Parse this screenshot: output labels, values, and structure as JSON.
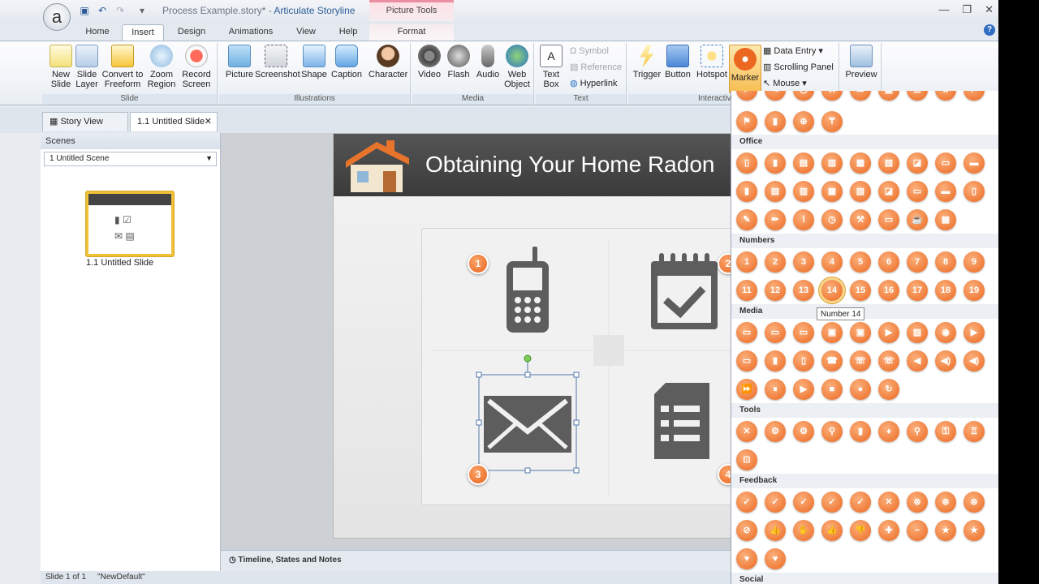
{
  "title": {
    "file": "Process Example.story*",
    "separator": " - ",
    "app": "Articulate Storyline",
    "contextual": "Picture Tools"
  },
  "tabs": [
    {
      "label": "Home"
    },
    {
      "label": "Insert",
      "active": true
    },
    {
      "label": "Design"
    },
    {
      "label": "Animations"
    },
    {
      "label": "View"
    },
    {
      "label": "Help"
    },
    {
      "label": "Format"
    }
  ],
  "ribbon": {
    "slide_group": {
      "label": "Slide",
      "buttons": [
        "New Slide",
        "Slide Layer",
        "Convert to Freeform",
        "Zoom Region",
        "Record Screen"
      ]
    },
    "illustrations_group": {
      "label": "Illustrations",
      "buttons": [
        "Picture",
        "Screenshot",
        "Shape",
        "Caption",
        "Character"
      ]
    },
    "media_group": {
      "label": "Media",
      "buttons": [
        "Video",
        "Flash",
        "Audio",
        "Web Object"
      ]
    },
    "text_group": {
      "label": "Text",
      "textbox": "Text Box",
      "symbol": "Symbol",
      "reference": "Reference",
      "hyperlink": "Hyperlink"
    },
    "interactive_group": {
      "label": "Interactiv",
      "buttons": [
        "Trigger",
        "Button",
        "Hotspot",
        "Marker"
      ],
      "data_entry": "Data Entry",
      "scrolling_panel": "Scrolling Panel",
      "mouse": "Mouse"
    },
    "preview_group": {
      "label": "Preview"
    }
  },
  "doc_tabs": {
    "story_view": "Story View",
    "untitled": "1.1 Untitled Slide"
  },
  "scenes": {
    "header": "Scenes",
    "selected": "1 Untitled Scene",
    "thumb_label": "1.1 Untitled Slide"
  },
  "slide": {
    "title": "Obtaining Your Home Radon",
    "badges": [
      "1",
      "2",
      "3",
      "4"
    ]
  },
  "timeline": "Timeline, States and Notes",
  "status": {
    "slide": "Slide 1 of 1",
    "theme": "\"NewDefault\""
  },
  "marker_menu": {
    "sections": [
      "Office",
      "Numbers",
      "Media",
      "Tools",
      "Feedback",
      "Social"
    ],
    "numbers_row1": [
      "1",
      "2",
      "3",
      "4",
      "5",
      "6",
      "7",
      "8",
      "9"
    ],
    "numbers_row2": [
      "11",
      "12",
      "13",
      "14",
      "15",
      "16",
      "17",
      "18",
      "19"
    ],
    "tooltip": "Number 14"
  },
  "colors": {
    "accent": "#ec6820",
    "ribbon_bg": "#e9eef4"
  }
}
